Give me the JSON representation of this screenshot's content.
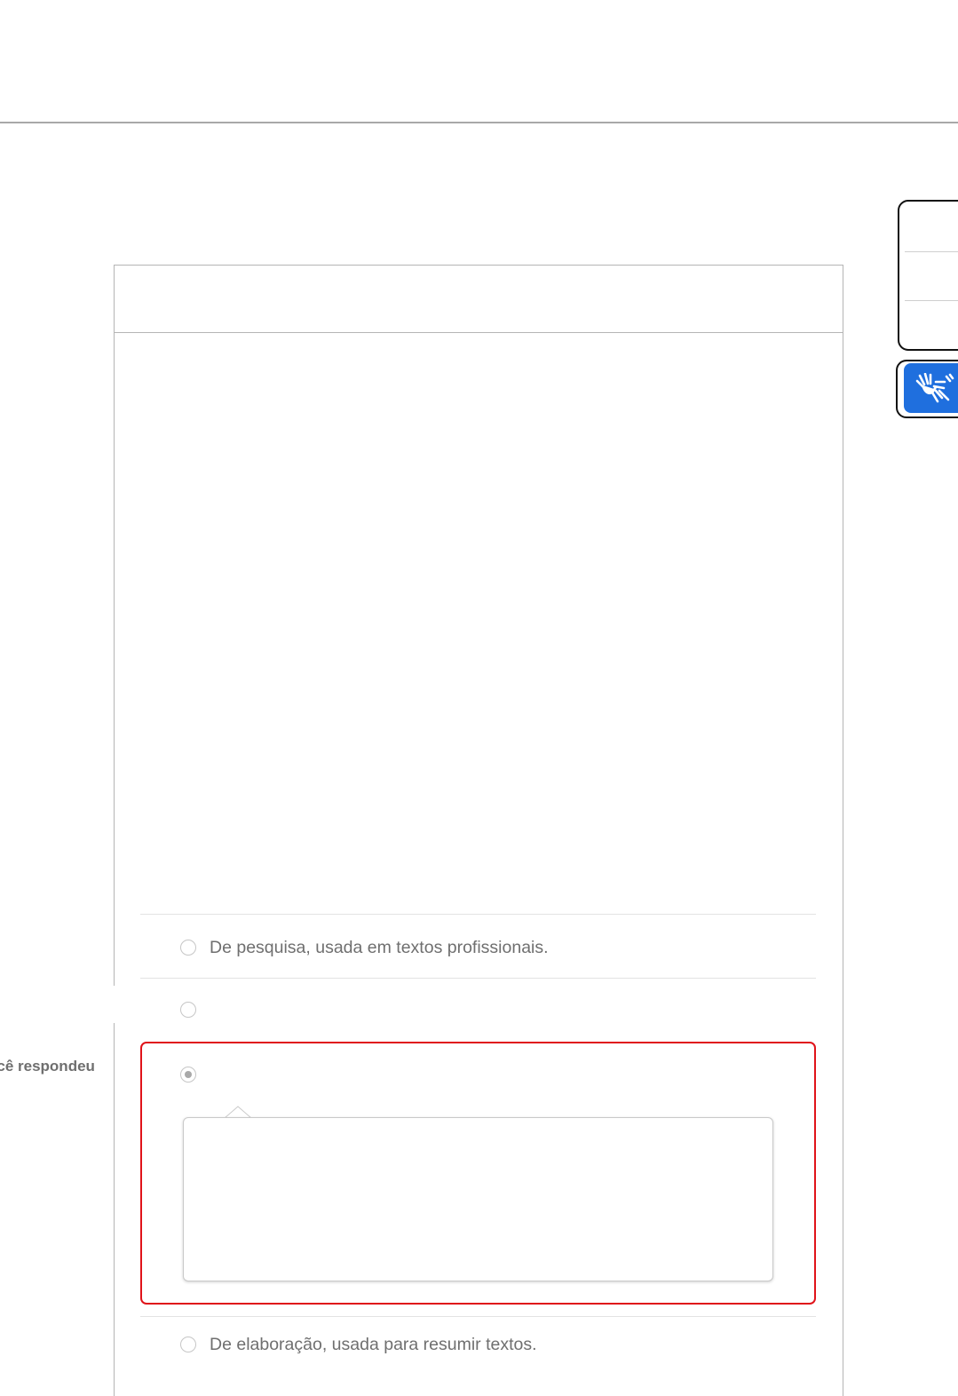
{
  "question": {
    "options": [
      {
        "label": "De pesquisa, usada em textos profissionais.",
        "selected": false
      },
      {
        "label": "",
        "selected": false
      },
      {
        "label": "",
        "selected": true
      },
      {
        "label": "De elaboração, usada para resumir textos.",
        "selected": false
      }
    ],
    "answered_label": "ocê respondeu",
    "feedback_text": ""
  },
  "accessibility": {
    "libras_icon": "sign-language-hands-icon"
  },
  "colors": {
    "wrong_answer_border": "#e0131a",
    "libras_button": "#1f6fde",
    "option_text": "#6f6f6f"
  }
}
